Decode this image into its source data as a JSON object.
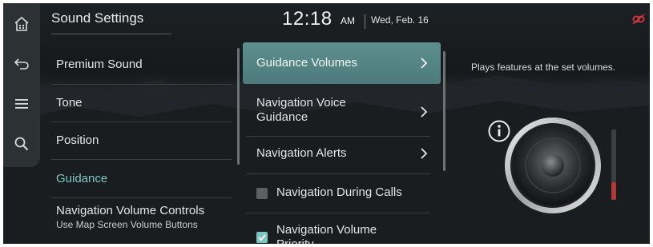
{
  "header": {
    "title": "Sound Settings",
    "time": "12:18",
    "ampm": "AM",
    "date": "Wed, Feb. 16"
  },
  "rail": {
    "icons": [
      "home-icon",
      "back-icon",
      "menu-icon",
      "search-icon"
    ]
  },
  "categories": {
    "items": [
      {
        "label": "Premium Sound",
        "active": false
      },
      {
        "label": "Tone",
        "active": false
      },
      {
        "label": "Position",
        "active": false
      },
      {
        "label": "Guidance",
        "active": true
      },
      {
        "label": "Navigation Volume Controls",
        "sublabel": "Use Map Screen Volume Buttons",
        "active": false
      }
    ]
  },
  "options": {
    "items": [
      {
        "label": "Guidance Volumes",
        "type": "link",
        "selected": true
      },
      {
        "label_line1": "Navigation Voice",
        "label_line2": "Guidance",
        "type": "link",
        "selected": false
      },
      {
        "label": "Navigation Alerts",
        "type": "link",
        "selected": false
      },
      {
        "label": "Navigation During Calls",
        "type": "checkbox",
        "checked": false
      },
      {
        "label_line1": "Navigation Volume",
        "label_line2": "Priority",
        "type": "checkbox",
        "checked": true
      }
    ]
  },
  "panel": {
    "description": "Plays features at the set volumes.",
    "volume_level": 0.25
  },
  "colors": {
    "accent": "#7fc7c0",
    "selected_bg": "#568584",
    "volume_fill": "#b13a36",
    "status_icon": "#d2383d"
  }
}
